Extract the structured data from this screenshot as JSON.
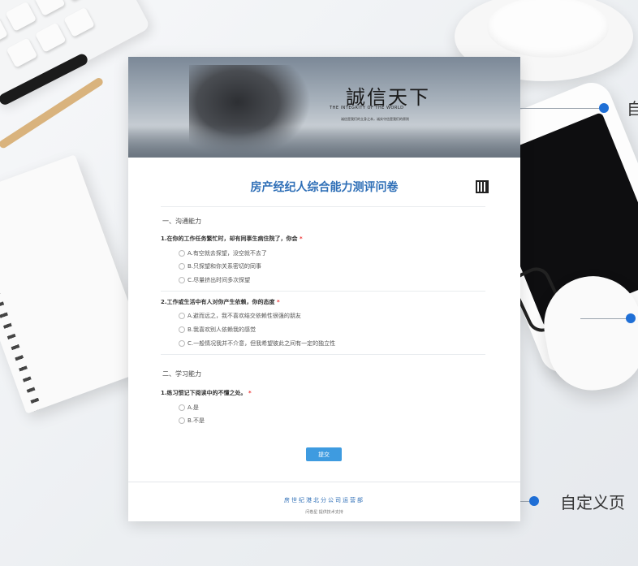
{
  "banner": {
    "slogan": "誠信天下",
    "slogan_en": "THE INTEGRITY OF THE WORLD",
    "slogan_sub": "诚信是我们的立身之本，诚实守信是我们的原则"
  },
  "survey": {
    "title": "房产经纪人综合能力测评问卷",
    "sections": [
      {
        "label": "一、沟通能力",
        "questions": [
          {
            "text": "1.在你的工作任务繁忙时，却有同事生病住院了，你会",
            "required": "*",
            "options": [
              "A.有空就去探望，没空就不去了",
              "B.只探望和你关系密切的同事",
              "C.尽量挤出时间多次探望"
            ]
          },
          {
            "text": "2.工作或生活中有人对你产生依赖，你的态度",
            "required": "*",
            "options": [
              "A.避而远之，我不喜欢结交依赖性很强的朋友",
              "B.我喜欢别人依赖我的感觉",
              "C.一般情况我并不介意，但我希望彼此之间有一定的独立性"
            ]
          }
        ]
      },
      {
        "label": "二、学习能力",
        "questions": [
          {
            "text": "1.练习惯记下阅读中的不懂之处。",
            "required": "*",
            "options": [
              "A.是",
              "B.不是"
            ]
          }
        ]
      }
    ],
    "submit_label": "提交"
  },
  "footer": {
    "title": "房世纪港北分公司运营部",
    "sub": "问卷星 提供技术支持"
  },
  "annotations": {
    "top": "自",
    "bottom": "自定义页"
  },
  "colors": {
    "accent": "#2f6fb7",
    "submit": "#3e9be0",
    "annotation_dot": "#1f6fd6"
  }
}
